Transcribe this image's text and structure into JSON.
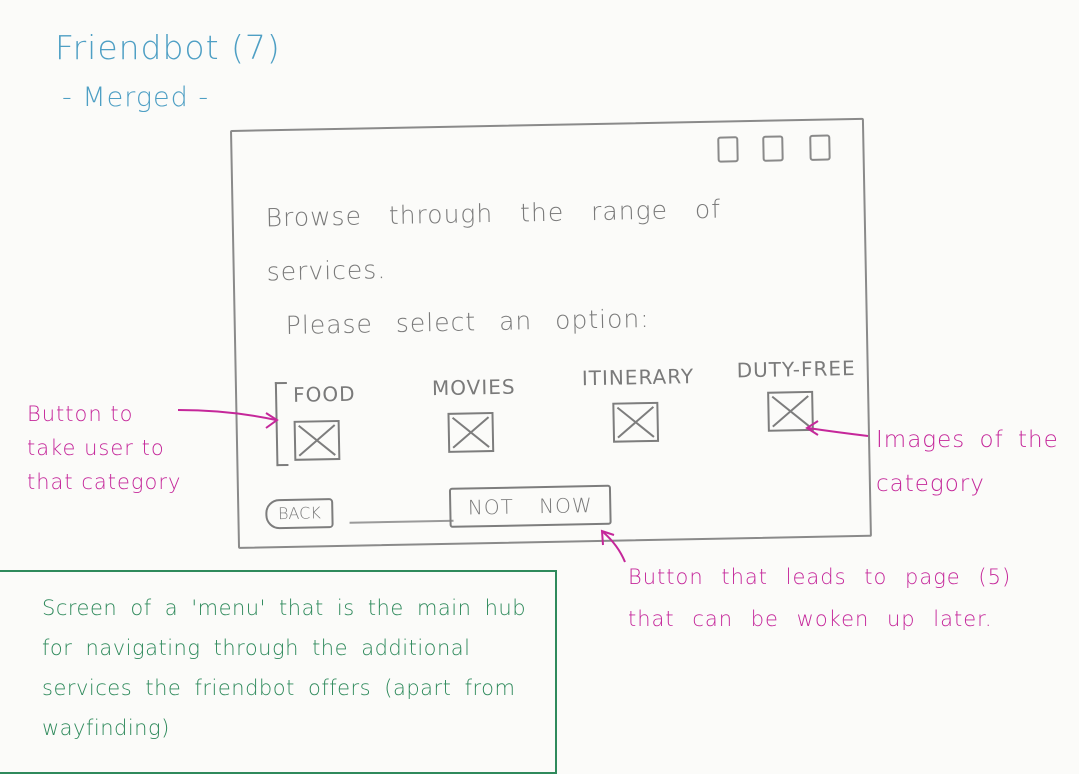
{
  "title": "Friendbot (7)",
  "subtitle": "- Merged -",
  "window": {
    "headline": "Browse through the range of services.",
    "prompt": "Please select an option:",
    "categories": [
      {
        "label": "Food"
      },
      {
        "label": "Movies"
      },
      {
        "label": "Itinerary"
      },
      {
        "label": "Duty-Free"
      }
    ],
    "back_label": "BACK",
    "not_now_label": "NOT NOW"
  },
  "annotations": {
    "button_note": "Button to take user to that category",
    "images_note": "Images of the category",
    "not_now_note": "Button that leads to page (5) that can be woken up later."
  },
  "screen_note": "Screen of a 'menu' that is the main hub for navigating through the additional services the friendbot offers (apart from wayfinding)",
  "colors": {
    "sketch": "#7a7a7a",
    "title": "#4e9fc4",
    "annotation": "#c5279a",
    "note": "#2f8a5c"
  }
}
